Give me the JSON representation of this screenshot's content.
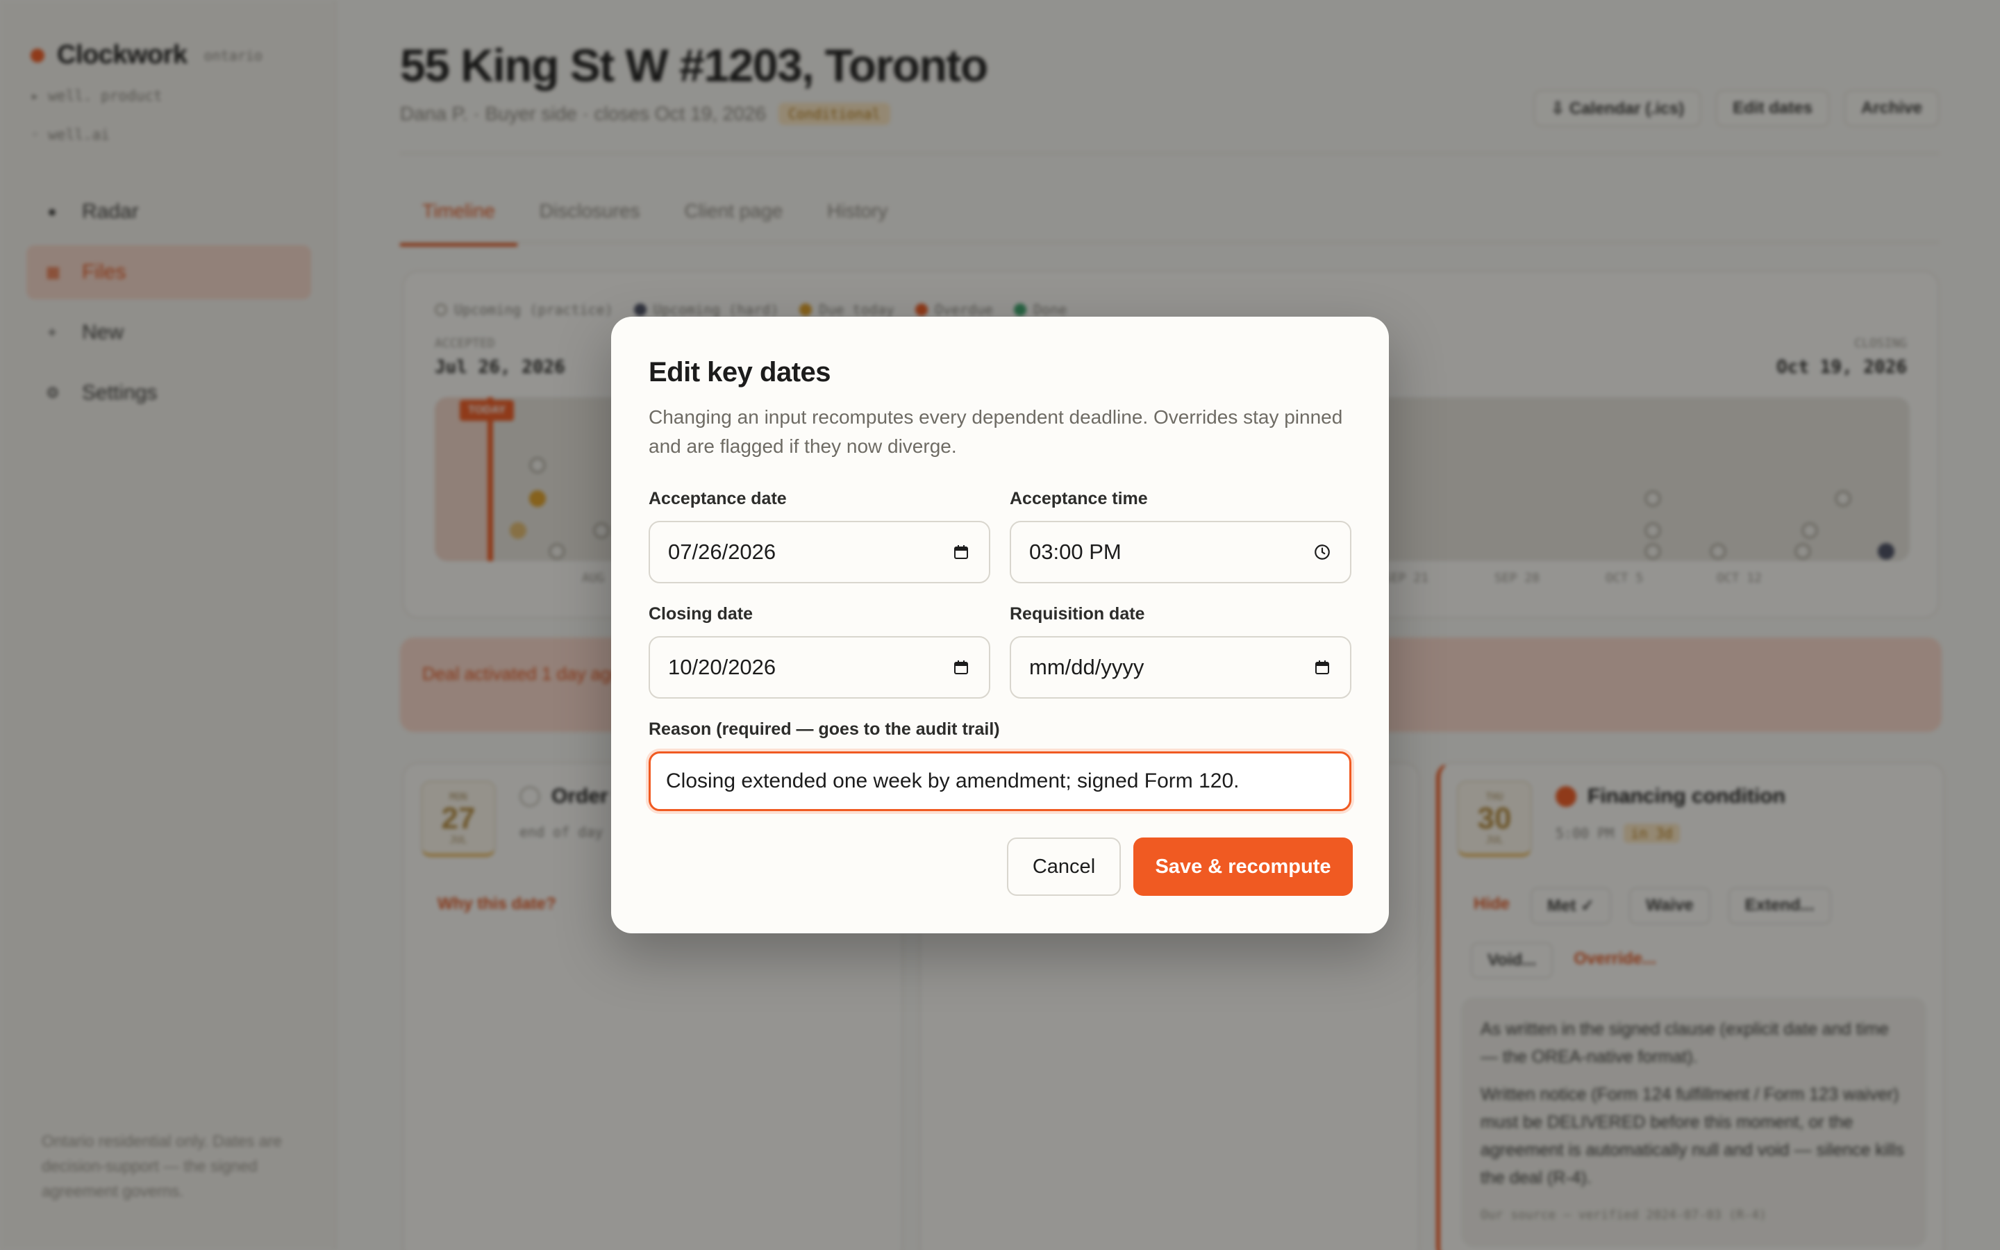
{
  "sidebar": {
    "brand": "Clockwork",
    "brand_tag": "ontario",
    "sub1": "▸ well. product",
    "sub2": "◦ well.ai",
    "items": [
      {
        "label": "Radar",
        "icon": "radar-icon",
        "glyph": "●"
      },
      {
        "label": "Files",
        "icon": "files-icon",
        "glyph": "▦"
      },
      {
        "label": "New",
        "icon": "plus-icon",
        "glyph": "+"
      },
      {
        "label": "Settings",
        "icon": "settings-icon",
        "glyph": "⚙"
      }
    ],
    "footer": "Ontario residential only. Dates are decision-support — the signed agreement governs."
  },
  "header": {
    "title": "55 King St W #1203, Toronto",
    "subtitle": "Dana P. · Buyer side · closes Oct 19, 2026",
    "status_badge": "Conditional",
    "actions": [
      "⇩ Calendar (.ics)",
      "Edit dates",
      "Archive"
    ]
  },
  "tabs": [
    "Timeline",
    "Disclosures",
    "Client page",
    "History"
  ],
  "timeline": {
    "legend": [
      "Upcoming (practice)",
      "Upcoming (hard)",
      "Due today",
      "Overdue",
      "Done"
    ],
    "acceptance_label": "ACCEPTED",
    "acceptance_date": "Jul 26, 2026",
    "closing_label": "CLOSING",
    "closing_date": "Oct 19, 2026",
    "today_flag": "TODAY",
    "ticks": [
      "AUG",
      "SEP 21",
      "SEP 28",
      "OCT 5",
      "OCT 12"
    ],
    "colors": {
      "practice": "#b8b4aa",
      "hard": "#4a4e63",
      "today": "#e0a028",
      "overdue": "#f05a22",
      "done": "#3aa36b"
    }
  },
  "alert": "Deal activated 1 day ago. Verify each one against the signed agreement immediately.",
  "cards": [
    {
      "month": "MON",
      "day": "27",
      "week": "JUL",
      "title": "Order title search",
      "meta": "end of day",
      "links": [
        "Why this date?"
      ]
    },
    {
      "month": "THU",
      "day": "30",
      "week": "JUL",
      "title": "Financing condition",
      "meta": "5:00 PM",
      "badge": "in 3d",
      "actions": [
        "Hide",
        "Met ✓",
        "Waive",
        "Extend...",
        "Void...",
        "Override..."
      ],
      "note1": "As written in the signed clause (explicit date and time — the OREA-native format).",
      "note2": "Written notice (Form 124 fulfillment / Form 123 waiver) must be DELIVERED before this moment, or the agreement is automatically null and void — silence kills the deal (R-4).",
      "source": "Our source — verified 2024-07-03 (R-4)"
    }
  ],
  "modal": {
    "title": "Edit key dates",
    "description": "Changing an input recomputes every dependent deadline. Overrides stay pinned and are flagged if they now diverge.",
    "acceptance_date_label": "Acceptance date",
    "acceptance_date_value": "07/26/2026",
    "acceptance_time_label": "Acceptance time",
    "acceptance_time_value": "03:00 PM",
    "closing_date_label": "Closing date",
    "closing_date_value": "10/20/2026",
    "requisition_date_label": "Requisition date",
    "requisition_date_value": "mm/dd/yyyy",
    "reason_label": "Reason (required — goes to the audit trail)",
    "reason_value": "Closing extended one week by amendment; signed Form 120.",
    "cancel_label": "Cancel",
    "save_label": "Save & recompute",
    "accent_color": "#f05a22"
  }
}
